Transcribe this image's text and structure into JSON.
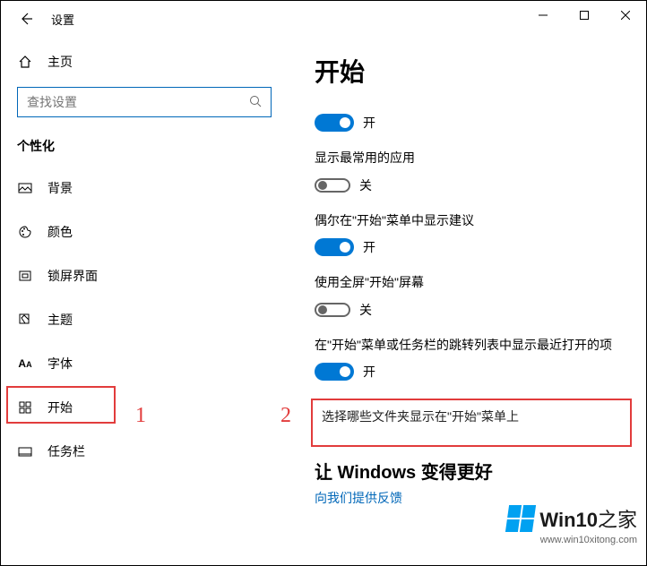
{
  "window": {
    "title": "设置"
  },
  "sidebar": {
    "home": "主页",
    "search_placeholder": "查找设置",
    "section": "个性化",
    "items": [
      {
        "label": "背景"
      },
      {
        "label": "颜色"
      },
      {
        "label": "锁屏界面"
      },
      {
        "label": "主题"
      },
      {
        "label": "字体"
      },
      {
        "label": "开始"
      },
      {
        "label": "任务栏"
      }
    ]
  },
  "main": {
    "heading": "开始",
    "settings": [
      {
        "label": null,
        "state": "on",
        "text": "开"
      },
      {
        "label": "显示最常用的应用",
        "state": "off",
        "text": "关"
      },
      {
        "label": "偶尔在\"开始\"菜单中显示建议",
        "state": "on",
        "text": "开"
      },
      {
        "label": "使用全屏\"开始\"屏幕",
        "state": "off",
        "text": "关"
      },
      {
        "label": "在\"开始\"菜单或任务栏的跳转列表中显示最近打开的项",
        "state": "on",
        "text": "开"
      }
    ],
    "link": "选择哪些文件夹显示在\"开始\"菜单上",
    "improve_title": "让 Windows 变得更好",
    "feedback": "向我们提供反馈"
  },
  "annotations": {
    "a1": "1",
    "a2": "2"
  },
  "watermark": {
    "brand": "Win10",
    "brand_zh": "之家",
    "url": "www.win10xitong.com"
  }
}
